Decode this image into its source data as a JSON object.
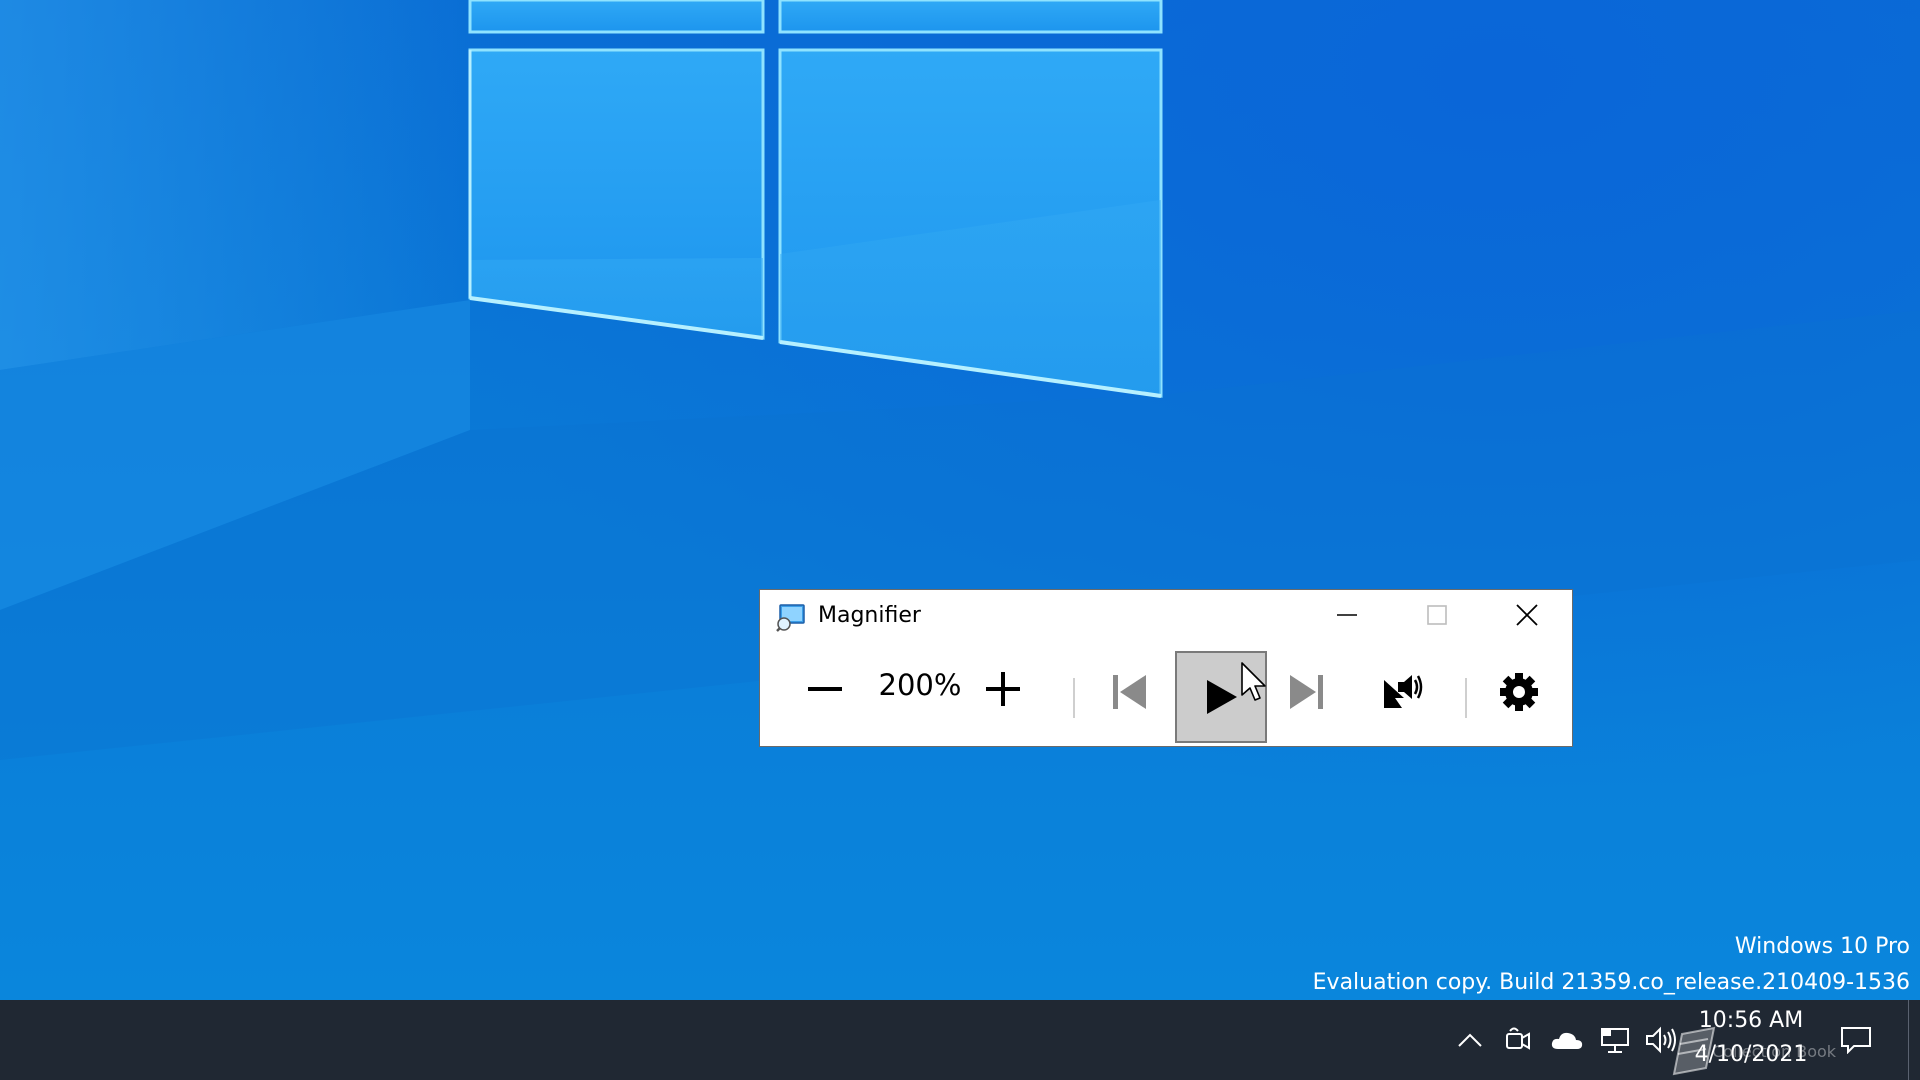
{
  "desktop": {
    "watermark_edition": "Windows 10 Pro",
    "watermark_build": "Evaluation copy. Build 21359.co_release.210409-1536"
  },
  "magnifier": {
    "title": "Magnifier",
    "zoom_level": "200%",
    "icons": {
      "app": "magnifier-app-icon",
      "minimize": "minimize-icon",
      "maximize": "maximize-icon",
      "close": "close-icon",
      "zoom_out": "minus-icon",
      "zoom_in": "plus-icon",
      "previous": "skip-previous-icon",
      "play": "play-icon",
      "next": "skip-next-icon",
      "read_from_pointer": "read-from-pointer-icon",
      "settings": "gear-icon"
    },
    "play_button_state": "pressed"
  },
  "taskbar": {
    "clock_time": "10:56 AM",
    "clock_date": "4/10/2021",
    "overlay_text": "Collection Book",
    "tray_icons": [
      "chevron-up-icon",
      "meet-now-icon",
      "onedrive-cloud-icon",
      "network-icon",
      "volume-icon",
      "notification-icon"
    ]
  },
  "colors": {
    "taskbar_bg": "#202833",
    "desktop_blue": "#0a78d6",
    "window_light": "#7fdcff",
    "button_pressed_bg": "#cccccc"
  }
}
